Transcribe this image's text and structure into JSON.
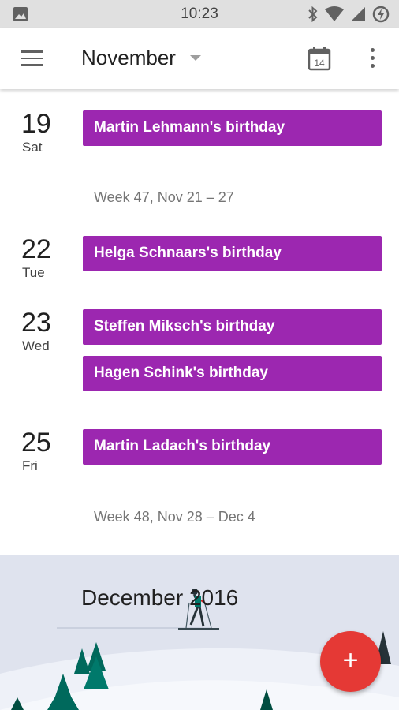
{
  "status_bar": {
    "time": "10:23",
    "icons": [
      "photo-icon",
      "bluetooth-icon",
      "wifi-icon",
      "signal-icon",
      "battery-charging-icon"
    ]
  },
  "app_bar": {
    "title": "November",
    "today_day": "14",
    "icons": [
      "menu-icon",
      "dropdown-caret-icon",
      "calendar-today-icon",
      "more-vert-icon"
    ]
  },
  "schedule": {
    "partial_day_label": "Wed",
    "days": [
      {
        "num": "19",
        "dow": "Sat",
        "events": [
          "Martin Lehmann's birthday"
        ]
      },
      {
        "num": "22",
        "dow": "Tue",
        "events": [
          "Helga Schnaars's birthday"
        ]
      },
      {
        "num": "23",
        "dow": "Wed",
        "events": [
          "Steffen Miksch's birthday",
          "Hagen Schink's birthday"
        ]
      },
      {
        "num": "25",
        "dow": "Fri",
        "events": [
          "Martin Ladach's birthday"
        ]
      }
    ],
    "weeks": [
      "Week 47, Nov 21 – 27",
      "Week 48, Nov 28 – Dec 4"
    ]
  },
  "month_banner": {
    "title": "December 2016"
  },
  "fab": {
    "label": "+"
  },
  "colors": {
    "event": "#9c27b0",
    "fab": "#e53935",
    "status_bar": "#e0e0e0",
    "banner_sky": "#dfe3ee"
  }
}
